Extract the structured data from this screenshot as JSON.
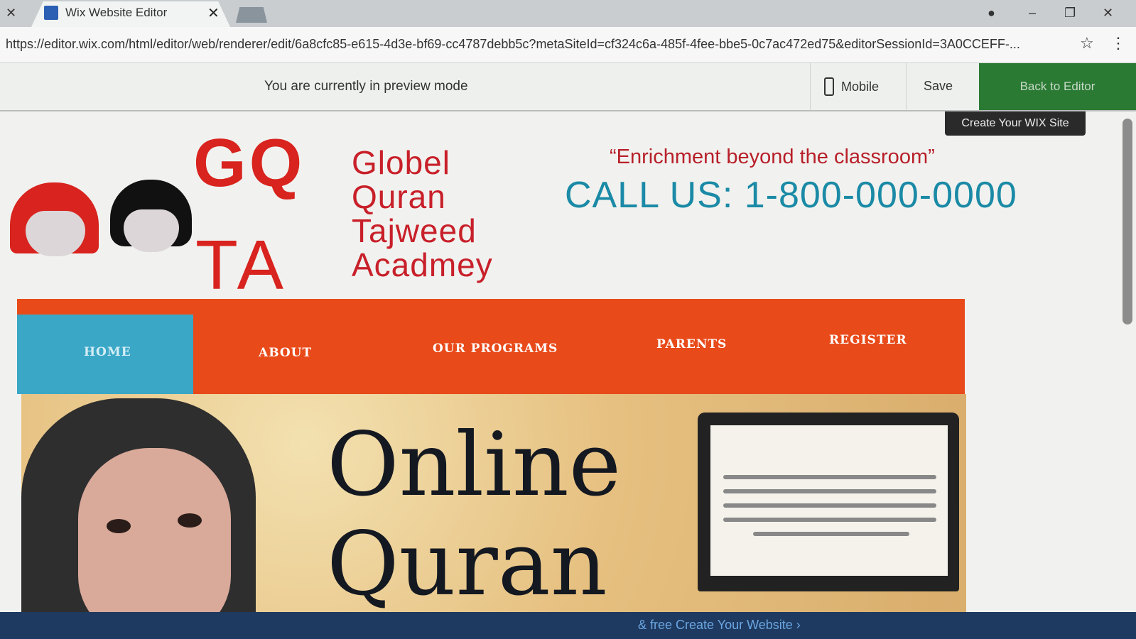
{
  "browser": {
    "tab_title": "Wix Website Editor",
    "tab_close": "✕",
    "left_close": "✕",
    "url": "https://editor.wix.com/html/editor/web/renderer/edit/6a8cfc85-e615-4d3e-bf69-cc4787debb5c?metaSiteId=cf324c6a-485f-4fee-bbe5-0c7ac472ed75&editorSessionId=3A0CCEFF-...",
    "star": "☆",
    "menu": "⋮",
    "profile": "●",
    "minimize": "–",
    "restore": "❐",
    "close": "✕"
  },
  "preview": {
    "message": "You are currently in preview mode",
    "mobile_label": "Mobile",
    "save_label": "Save",
    "back_label": "Back to Editor"
  },
  "site": {
    "create_wix": "Create Your WIX Site",
    "logo_top": "GQ",
    "logo_bottom": "TA",
    "academy_lines": [
      "Globel",
      "Quran",
      "Tajweed",
      "Acadmey"
    ],
    "tagline": "“Enrichment beyond the classroom”",
    "call_us": "CALL US: 1-800-000-0000",
    "nav": [
      "HOME",
      "ABOUT",
      "OUR PROGRAMS",
      "PARENTS",
      "REGISTER"
    ],
    "hero_line1": "Online",
    "hero_line2": "Quran",
    "banner": "& free  Create Your Website ›"
  },
  "colors": {
    "brand_red": "#d8231e",
    "nav_orange": "#e84a1a",
    "nav_home_blue": "#3aa7c7",
    "call_blue": "#1a8aa6",
    "editor_green": "#2a7a34"
  }
}
